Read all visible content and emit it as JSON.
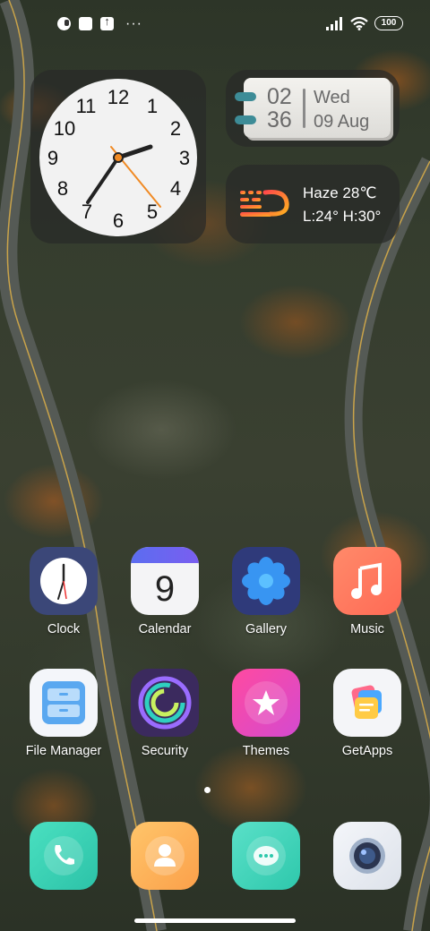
{
  "status_bar": {
    "left_icons": [
      "notification-app-icon",
      "notification-square-icon",
      "upload-icon"
    ],
    "more": "···",
    "signal_icon": "signal-bars-icon",
    "wifi_icon": "wifi-icon",
    "battery": "100"
  },
  "clock_widget": {
    "numbers": [
      "12",
      "1",
      "2",
      "3",
      "4",
      "5",
      "6",
      "7",
      "8",
      "9",
      "10",
      "11"
    ],
    "time_shown": "02:36",
    "colors": {
      "face": "#f2f2f2",
      "second_hand": "#f08a24",
      "hands": "#222222"
    }
  },
  "date_widget": {
    "hour": "02",
    "minute": "36",
    "day": "Wed",
    "date": "09 Aug"
  },
  "weather_widget": {
    "condition": "Haze",
    "temperature": "28℃",
    "range": "L:24° H:30°",
    "icon": "haze-icon",
    "icon_color": "#ff6a3d"
  },
  "apps": [
    {
      "label": "Clock",
      "icon": "clock-icon"
    },
    {
      "label": "Calendar",
      "icon": "calendar-icon",
      "badge_text": "9"
    },
    {
      "label": "Gallery",
      "icon": "gallery-flower-icon"
    },
    {
      "label": "Music",
      "icon": "music-note-icon"
    },
    {
      "label": "File Manager",
      "icon": "file-cabinet-icon"
    },
    {
      "label": "Security",
      "icon": "security-rings-icon"
    },
    {
      "label": "Themes",
      "icon": "star-icon"
    },
    {
      "label": "GetApps",
      "icon": "getapps-cards-icon"
    }
  ],
  "dock": [
    {
      "icon": "phone-icon",
      "color": "#3ccfb0"
    },
    {
      "icon": "contacts-icon",
      "color": "#fbb35a"
    },
    {
      "icon": "messages-icon",
      "color": "#46d4b8"
    },
    {
      "icon": "camera-icon",
      "color": "#e8ecf2"
    }
  ],
  "page_indicator": {
    "current": 1,
    "total": 1
  }
}
